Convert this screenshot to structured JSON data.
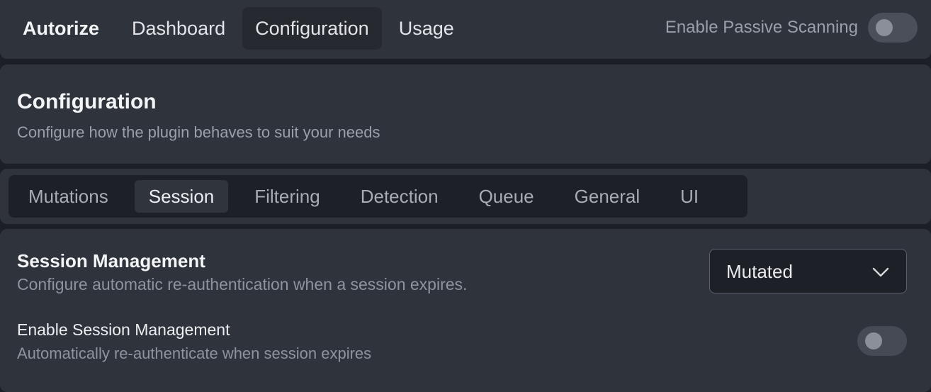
{
  "topnav": {
    "brand": "Autorize",
    "items": [
      {
        "label": "Dashboard",
        "active": false
      },
      {
        "label": "Configuration",
        "active": true
      },
      {
        "label": "Usage",
        "active": false
      }
    ],
    "passive_scanning": {
      "label": "Enable Passive Scanning",
      "enabled": false
    }
  },
  "header": {
    "title": "Configuration",
    "subtitle": "Configure how the plugin behaves to suit your needs"
  },
  "tabs": [
    {
      "label": "Mutations",
      "active": false
    },
    {
      "label": "Session",
      "active": true
    },
    {
      "label": "Filtering",
      "active": false
    },
    {
      "label": "Detection",
      "active": false
    },
    {
      "label": "Queue",
      "active": false
    },
    {
      "label": "General",
      "active": false
    },
    {
      "label": "UI",
      "active": false
    }
  ],
  "session": {
    "title": "Session Management",
    "description": "Configure automatic re-authentication when a session expires.",
    "mode_select": {
      "value": "Mutated"
    },
    "enable": {
      "label": "Enable Session Management",
      "description": "Automatically re-authenticate when session expires",
      "enabled": false
    }
  },
  "icons": {
    "chevron": "chevron-down-icon"
  },
  "colors": {
    "background": "#1c1f25",
    "panel": "#2f333c",
    "inset": "#1d2026"
  }
}
